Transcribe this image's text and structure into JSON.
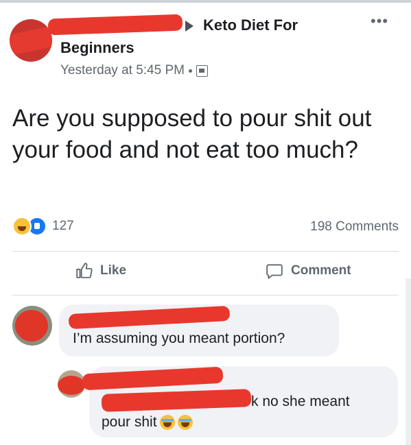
{
  "header": {
    "group_name_line1": "Keto Diet For",
    "group_name_line2": "Beginners",
    "more_label": "•••",
    "timestamp": "Yesterday at 5:45 PM",
    "privacy_icon": "public-icon"
  },
  "post": {
    "text": "Are you supposed to pour shit out your food and not eat too much?"
  },
  "stats": {
    "reaction_icons": [
      "haha-icon",
      "like-icon"
    ],
    "reaction_count": "127",
    "comment_count": "198 Comments"
  },
  "actions": {
    "like_label": "Like",
    "comment_label": "Comment"
  },
  "comments": [
    {
      "text": "I’m assuming you meant portion?"
    },
    {
      "text_line1": "k no she meant",
      "text_line2": "pour shit"
    }
  ],
  "colors": {
    "redaction": "#e8382e",
    "bubble_bg": "#f0f2f5",
    "secondary_text": "#606770",
    "like_blue": "#1877f2"
  }
}
